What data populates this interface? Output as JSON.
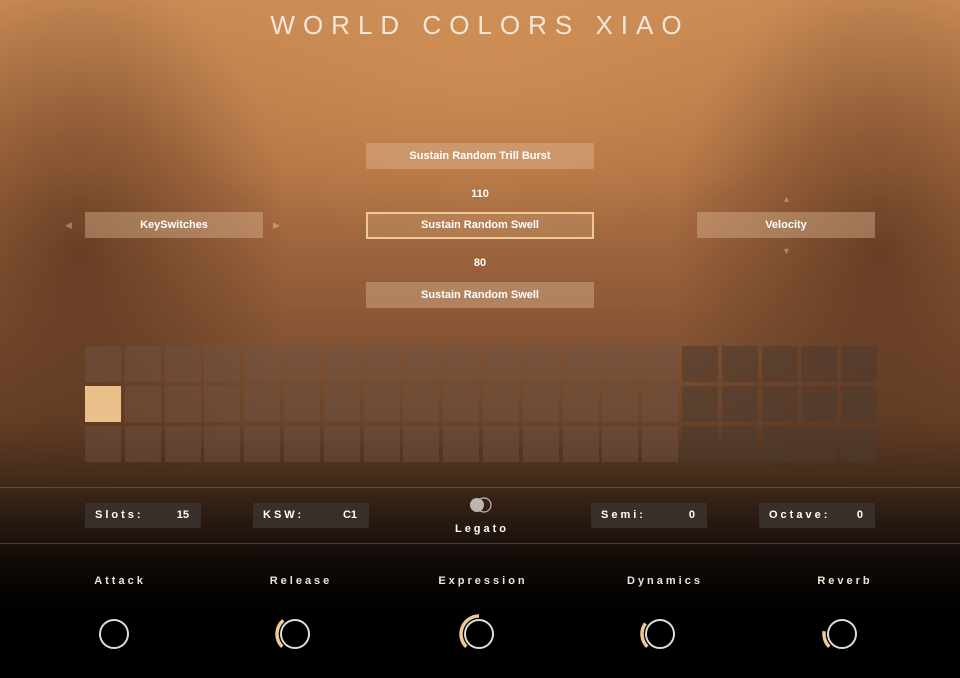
{
  "title": "WORLD COLORS XIAO",
  "articulations": {
    "upper": "Sustain Random Trill Burst",
    "upper_value": "110",
    "current": "Sustain Random Swell",
    "lower_value": "80",
    "lower": "Sustain Random Swell"
  },
  "left_selector": {
    "label": "KeySwitches"
  },
  "right_selector": {
    "label": "Velocity"
  },
  "slots_grid": {
    "rows": 3,
    "columns": 20,
    "active_columns": 15,
    "selected_row": 2,
    "selected_column": 1
  },
  "fields": {
    "slots": {
      "label": "Slots:",
      "value": "15"
    },
    "ksw": {
      "label": "KSW:",
      "value": "C1"
    },
    "legato": {
      "label": "Legato",
      "on": false
    },
    "semi": {
      "label": "Semi:",
      "value": "0"
    },
    "octave": {
      "label": "Octave:",
      "value": "0"
    }
  },
  "knobs": [
    {
      "label": "Attack",
      "value": 0.0
    },
    {
      "label": "Release",
      "value": 0.35
    },
    {
      "label": "Expression",
      "value": 0.5
    },
    {
      "label": "Dynamics",
      "value": 0.3
    },
    {
      "label": "Reverb",
      "value": 0.2
    }
  ],
  "colors": {
    "accent": "#f0c894",
    "cell_selected": "#e9c08a",
    "knob_ring": "#dcdcdc"
  }
}
